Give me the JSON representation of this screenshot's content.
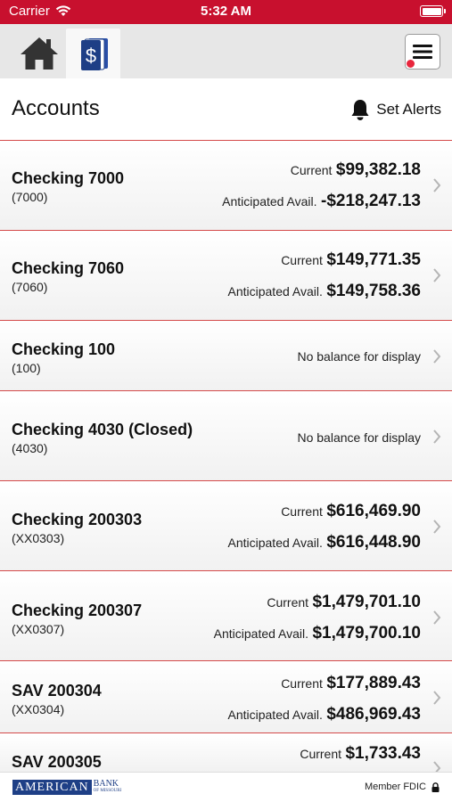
{
  "status_bar": {
    "carrier": "Carrier",
    "time": "5:32 AM"
  },
  "colors": {
    "brand_red": "#c8102e",
    "divider_red": "#d44a4a",
    "navy": "#1e3f86",
    "badge_red": "#e8253c"
  },
  "tabs": [
    {
      "name": "home",
      "icon": "house-icon"
    },
    {
      "name": "accounts",
      "icon": "dollar-cards-icon",
      "selected": true
    }
  ],
  "header": {
    "title": "Accounts",
    "alerts_label": "Set Alerts"
  },
  "accounts": [
    {
      "name": "Checking 7000",
      "number": "(7000)",
      "current_label": "Current",
      "current": "$99,382.18",
      "anticipated_label": "Anticipated Avail.",
      "anticipated": "-$218,247.13"
    },
    {
      "name": "Checking 7060",
      "number": "(7060)",
      "current_label": "Current",
      "current": "$149,771.35",
      "anticipated_label": "Anticipated Avail.",
      "anticipated": "$149,758.36"
    },
    {
      "name": "Checking 100",
      "number": "(100)",
      "no_balance": "No balance for display"
    },
    {
      "name": "Checking 4030 (Closed)",
      "number": "(4030)",
      "no_balance": "No balance for display"
    },
    {
      "name": "Checking 200303",
      "number": "(XX0303)",
      "current_label": "Current",
      "current": "$616,469.90",
      "anticipated_label": "Anticipated Avail.",
      "anticipated": "$616,448.90"
    },
    {
      "name": "Checking 200307",
      "number": "(XX0307)",
      "current_label": "Current",
      "current": "$1,479,701.10",
      "anticipated_label": "Anticipated Avail.",
      "anticipated": "$1,479,700.10"
    },
    {
      "name": "SAV 200304",
      "number": "(XX0304)",
      "current_label": "Current",
      "current": "$177,889.43",
      "anticipated_label": "Anticipated Avail.",
      "anticipated": "$486,969.43"
    },
    {
      "name": "SAV 200305",
      "current_label": "Current",
      "current": "$1,733.43"
    }
  ],
  "footer": {
    "logo_word": "AMERICAN",
    "logo_bank": "BANK",
    "logo_sub": "OF MISSOURI",
    "fdic": "Member FDIC"
  }
}
